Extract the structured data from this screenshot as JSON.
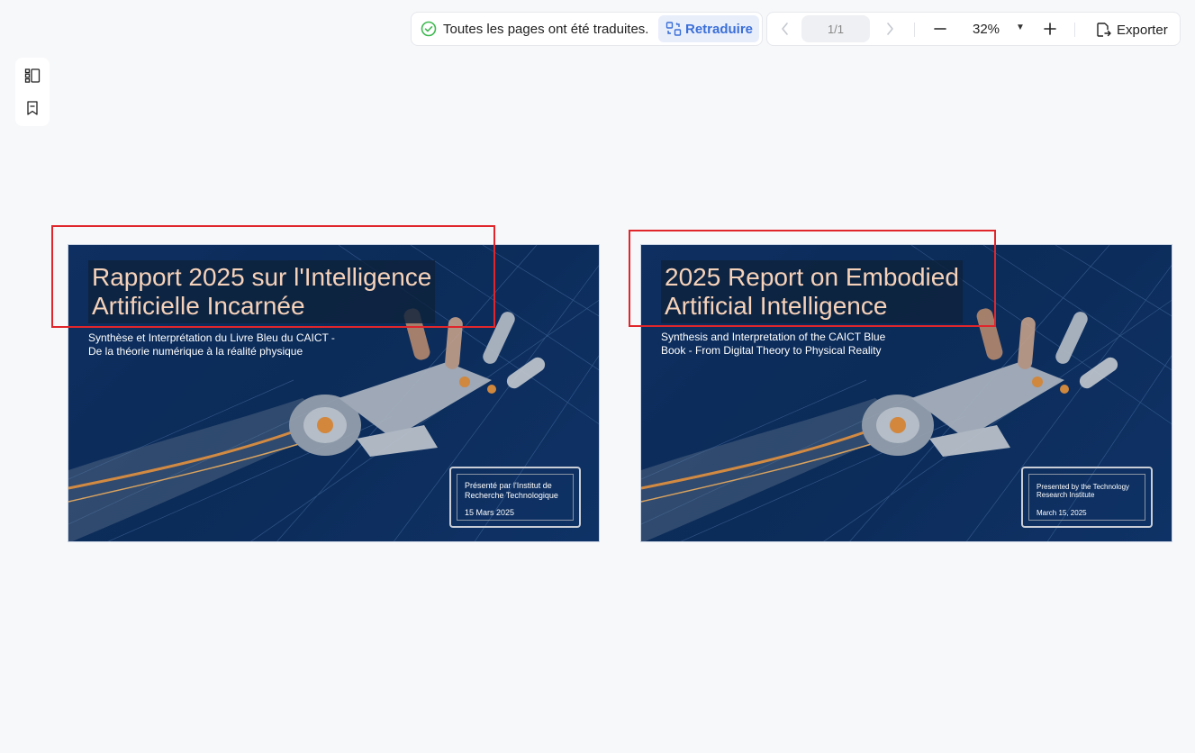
{
  "toolbar": {
    "status_text": "Toutes les pages ont été traduites.",
    "retranslate_label": "Retraduire",
    "page_indicator": "1/1",
    "zoom_value": "32%",
    "export_label": "Exporter"
  },
  "colors": {
    "accent": "#3a6fd8",
    "success": "#3fb950",
    "highlight_border": "#e0262b",
    "slide_bg": "#0e2f61",
    "title_text": "#f6d2ba"
  },
  "slides": {
    "original": {
      "title": "Rapport 2025 sur l'Intelligence\nArtificielle Incarnée",
      "subtitle": "Synthèse et Interprétation du Livre Bleu du CAICT -\nDe la théorie numérique à la réalité physique",
      "presenter": "Présenté par l'Institut de\nRecherche Technologique",
      "date": "15 Mars 2025"
    },
    "translated": {
      "title": "2025 Report on Embodied\nArtificial Intelligence",
      "subtitle": "Synthesis and Interpretation of the CAICT Blue\nBook - From Digital Theory to Physical Reality",
      "presenter": "Presented by the Technology\nResearch Institute",
      "date": "March 15, 2025"
    }
  },
  "icons": {
    "status": "check-circle-icon",
    "retranslate": "translate-icon",
    "prev": "chevron-left-icon",
    "next": "chevron-right-icon",
    "zoom_out": "minus-icon",
    "zoom_in": "plus-icon",
    "export": "export-icon",
    "thumbnails": "thumbnails-icon",
    "bookmark": "bookmark-icon"
  }
}
